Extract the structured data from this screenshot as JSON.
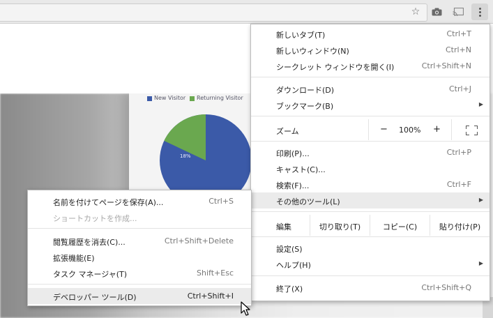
{
  "toolbar": {
    "star": "☆",
    "camera": "📷",
    "cast": "⧉"
  },
  "page": {
    "legend": [
      {
        "label": "New Visitor",
        "color": "#3b5aa8"
      },
      {
        "label": "Returning Visitor",
        "color": "#6aa84f"
      }
    ],
    "pie_label": "18%",
    "pie_share": 0.18
  },
  "menu": {
    "items": [
      {
        "label": "新しいタブ(T)",
        "shortcut": "Ctrl+T"
      },
      {
        "label": "新しいウィンドウ(N)",
        "shortcut": "Ctrl+N"
      },
      {
        "label": "シークレット ウィンドウを開く(I)",
        "shortcut": "Ctrl+Shift+N"
      },
      {
        "label": "ダウンロード(D)",
        "shortcut": "Ctrl+J"
      },
      {
        "label": "ブックマーク(B)",
        "shortcut": ""
      },
      {
        "label": "印刷(P)...",
        "shortcut": "Ctrl+P"
      },
      {
        "label": "キャスト(C)...",
        "shortcut": ""
      },
      {
        "label": "検索(F)...",
        "shortcut": "Ctrl+F"
      },
      {
        "label": "その他のツール(L)",
        "shortcut": ""
      },
      {
        "label": "設定(S)",
        "shortcut": ""
      },
      {
        "label": "ヘルプ(H)",
        "shortcut": ""
      },
      {
        "label": "終了(X)",
        "shortcut": "Ctrl+Shift+Q"
      }
    ],
    "arrow": "▶",
    "zoom": {
      "label": "ズーム",
      "minus": "−",
      "value": "100%",
      "plus": "+"
    },
    "edit": {
      "label": "編集",
      "cut": "切り取り(T)",
      "copy": "コピー(C)",
      "paste": "貼り付け(P)"
    }
  },
  "submenu": {
    "items": [
      {
        "label": "名前を付けてページを保存(A)...",
        "shortcut": "Ctrl+S"
      },
      {
        "label": "ショートカットを作成...",
        "shortcut": ""
      },
      {
        "label": "閲覧履歴を消去(C)...",
        "shortcut": "Ctrl+Shift+Delete"
      },
      {
        "label": "拡張機能(E)",
        "shortcut": ""
      },
      {
        "label": "タスク マネージャ(T)",
        "shortcut": "Shift+Esc"
      },
      {
        "label": "デベロッパー ツール(D)",
        "shortcut": "Ctrl+Shift+I"
      }
    ]
  }
}
